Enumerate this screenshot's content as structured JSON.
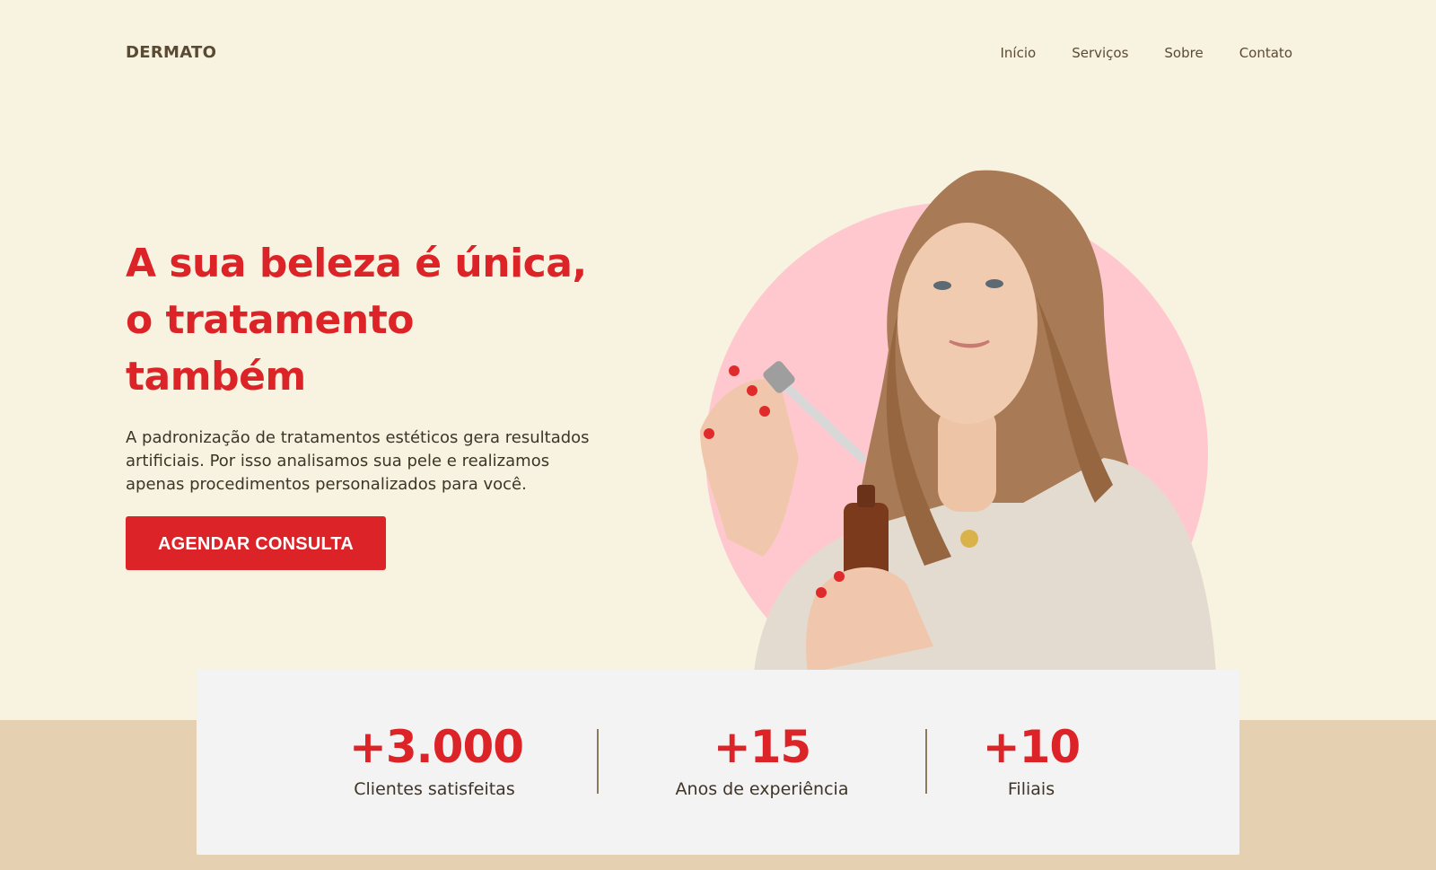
{
  "header": {
    "logo": "DERMATO",
    "nav": [
      "Início",
      "Serviços",
      "Sobre",
      "Contato"
    ]
  },
  "hero": {
    "title_lines": [
      "A sua beleza é única,",
      "o tratamento",
      "também"
    ],
    "description": "A padronização de tratamentos estéticos gera resultados artificiais. Por isso analisamos sua pele e realizamos apenas procedimentos personalizados para você.",
    "cta_label": "AGENDAR CONSULTA",
    "image_icon": "woman-holding-serum-dropper-photo"
  },
  "stats": [
    {
      "value": "+3.000",
      "label": "Clientes satisfeitas"
    },
    {
      "value": "+15",
      "label": "Anos de experiência"
    },
    {
      "value": "+10",
      "label": "Filiais"
    }
  ],
  "colors": {
    "background": "#F8F2E0",
    "accent": "#DC2428",
    "band": "#E5D1B1",
    "card": "#F3F3F3",
    "circle": "#FFC8CE",
    "text": "#3E3428"
  }
}
